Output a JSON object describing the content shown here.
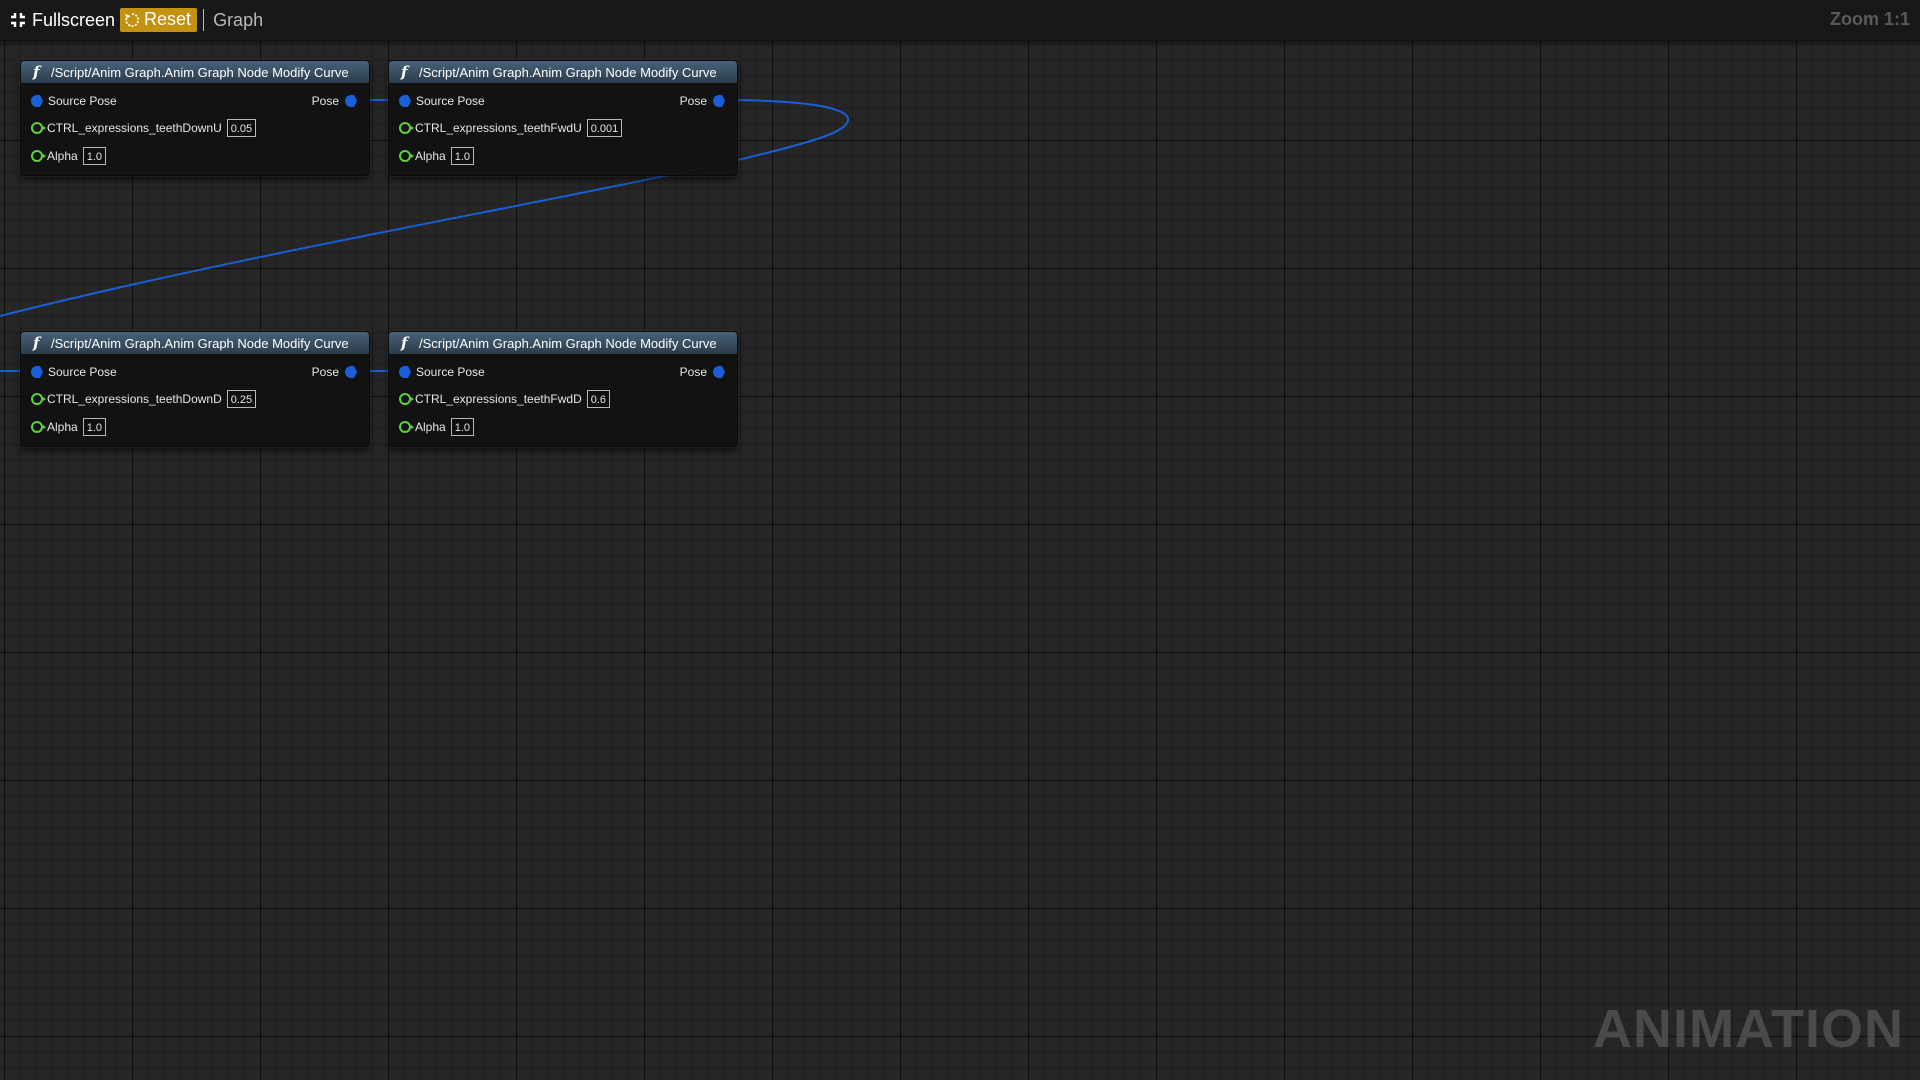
{
  "toolbar": {
    "fullscreen_label": "Fullscreen",
    "reset_label": "Reset",
    "graph_label": "Graph",
    "zoom_label": "Zoom 1:1"
  },
  "watermark": "ANIMATION",
  "colors": {
    "exec_pin": "#1a5fd6",
    "float_pin": "#5bd33a",
    "reset_bg": "#c39213",
    "header_top": "#47627a",
    "wire": "#1a5fd6"
  },
  "nodes": [
    {
      "title": "/Script/Anim Graph.Anim Graph Node Modify Curve",
      "icon": "function-icon",
      "source_pose": "Source Pose",
      "output": "Pose",
      "curve_name": "CTRL_expressions_teethDownU",
      "curve_value": "0.05",
      "alpha_label": "Alpha",
      "alpha_value": "1.0"
    },
    {
      "title": "/Script/Anim Graph.Anim Graph Node Modify Curve",
      "icon": "function-icon",
      "source_pose": "Source Pose",
      "output": "Pose",
      "curve_name": "CTRL_expressions_teethFwdU",
      "curve_value": "0.001",
      "alpha_label": "Alpha",
      "alpha_value": "1.0"
    },
    {
      "title": "/Script/Anim Graph.Anim Graph Node Modify Curve",
      "icon": "function-icon",
      "source_pose": "Source Pose",
      "output": "Pose",
      "curve_name": "CTRL_expressions_teethDownD",
      "curve_value": "0.25",
      "alpha_label": "Alpha",
      "alpha_value": "1.0"
    },
    {
      "title": "/Script/Anim Graph.Anim Graph Node Modify Curve",
      "icon": "function-icon",
      "source_pose": "Source Pose",
      "output": "Pose",
      "curve_name": "CTRL_expressions_teethFwdD",
      "curve_value": "0.6",
      "alpha_label": "Alpha",
      "alpha_value": "1.0"
    }
  ]
}
